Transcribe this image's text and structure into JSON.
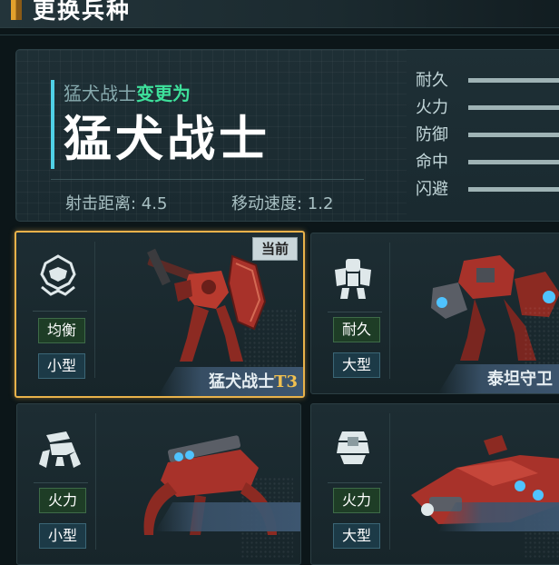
{
  "header": {
    "title": "更换兵种"
  },
  "summary": {
    "from_unit": "猛犬战士",
    "change_verb": "变更为",
    "target_unit": "猛犬战士",
    "range_text": "射击距离: 4.5",
    "speed_text": "移动速度: 1.2"
  },
  "attributes": [
    {
      "label": "耐久",
      "level": 0.9
    },
    {
      "label": "火力",
      "level": 0.9
    },
    {
      "label": "防御",
      "level": 0.9
    },
    {
      "label": "命中",
      "level": 0.9
    },
    {
      "label": "闪避",
      "level": 0.9
    }
  ],
  "units": [
    {
      "role": "均衡",
      "size": "小型",
      "name": "猛犬战士",
      "tier": "T3",
      "current_tag": "当前",
      "selected": true,
      "icon": "balanced-class-icon"
    },
    {
      "role": "耐久",
      "size": "大型",
      "name": "泰坦守卫",
      "tier": "",
      "selected": false,
      "icon": "durability-class-icon"
    },
    {
      "role": "火力",
      "size": "小型",
      "name": "",
      "tier": "",
      "selected": false,
      "icon": "firepower-class-icon"
    },
    {
      "role": "火力",
      "size": "大型",
      "name": "",
      "tier": "",
      "selected": false,
      "icon": "firepower-class-icon"
    }
  ],
  "colors": {
    "accent": "#4fd0e6",
    "change_verb": "#3ee09b",
    "selected_border": "#e9b24a",
    "tier": "#f0c050"
  }
}
